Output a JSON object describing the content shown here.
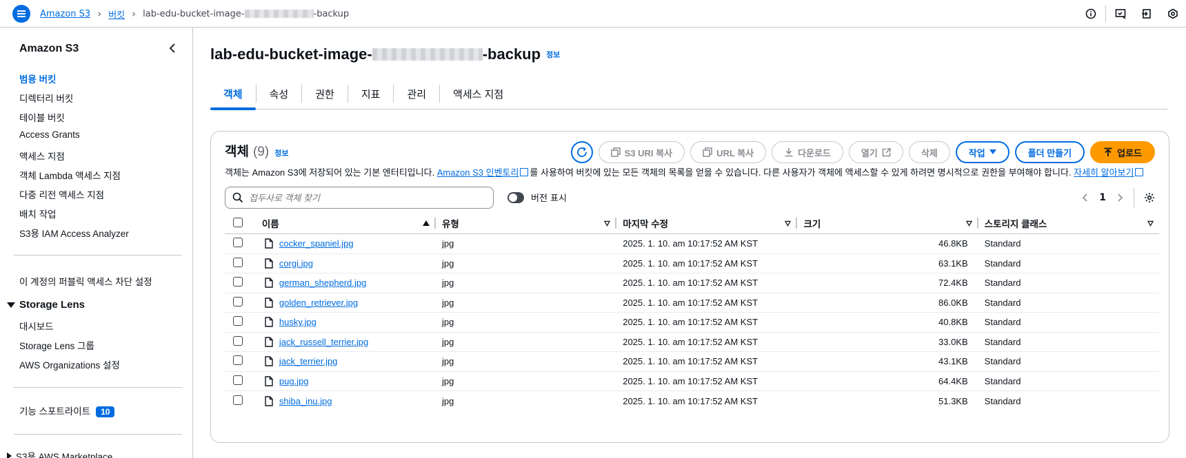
{
  "breadcrumb": {
    "root": "Amazon S3",
    "buckets": "버킷",
    "current_prefix": "lab-edu-bucket-image-",
    "current_suffix": "-backup"
  },
  "sidebar": {
    "title": "Amazon S3",
    "items": [
      {
        "label": "범용 버킷",
        "active": true
      },
      {
        "label": "디렉터리 버킷"
      },
      {
        "label": "테이블 버킷"
      },
      {
        "label": "Access Grants"
      },
      {
        "label": "액세스 지점"
      },
      {
        "label": "객체 Lambda 액세스 지점"
      },
      {
        "label": "다중 리전 액세스 지점"
      },
      {
        "label": "배치 작업"
      },
      {
        "label": "S3용 IAM Access Analyzer"
      }
    ],
    "public_block": "이 계정의 퍼블릭 액세스 차단 설정",
    "storage_lens": {
      "title": "Storage Lens",
      "items": [
        "대시보드",
        "Storage Lens 그룹",
        "AWS Organizations 설정"
      ]
    },
    "spotlight": {
      "label": "기능 스포트라이트",
      "badge": "10"
    },
    "marketplace": "S3용 AWS Marketplace"
  },
  "page": {
    "title_prefix": "lab-edu-bucket-image-",
    "title_suffix": "-backup",
    "info": "정보"
  },
  "tabs": [
    "객체",
    "속성",
    "권한",
    "지표",
    "관리",
    "액세스 지점"
  ],
  "objects": {
    "title": "객체",
    "count": "(9)",
    "info": "정보",
    "desc_1": "객체는 Amazon S3에 저장되어 있는 기본 엔터티입니다. ",
    "desc_link": "Amazon S3 인벤토리",
    "desc_2": "를 사용하여 버킷에 있는 모든 객체의 목록을 얻을 수 있습니다. 다른 사용자가 객체에 액세스할 수 있게 하려면 명시적으로 권한을 부여해야 합니다. ",
    "learn_more": "자세히 알아보기",
    "buttons": {
      "copy_s3_uri": "S3 URI 복사",
      "copy_url": "URL 복사",
      "download": "다운로드",
      "open": "열기",
      "delete": "삭제",
      "actions": "작업",
      "create_folder": "폴더 만들기",
      "upload": "업로드"
    },
    "search_placeholder": "접두사로 객체 찾기",
    "show_versions": "버전 표시",
    "page": "1",
    "columns": [
      "이름",
      "유형",
      "마지막 수정",
      "크기",
      "스토리지 클래스"
    ],
    "rows": [
      {
        "name": "cocker_spaniel.jpg",
        "type": "jpg",
        "modified": "2025. 1. 10. am 10:17:52 AM KST",
        "size": "46.8KB",
        "class": "Standard"
      },
      {
        "name": "corgi.jpg",
        "type": "jpg",
        "modified": "2025. 1. 10. am 10:17:52 AM KST",
        "size": "63.1KB",
        "class": "Standard"
      },
      {
        "name": "german_shepherd.jpg",
        "type": "jpg",
        "modified": "2025. 1. 10. am 10:17:52 AM KST",
        "size": "72.4KB",
        "class": "Standard"
      },
      {
        "name": "golden_retriever.jpg",
        "type": "jpg",
        "modified": "2025. 1. 10. am 10:17:52 AM KST",
        "size": "86.0KB",
        "class": "Standard"
      },
      {
        "name": "husky.jpg",
        "type": "jpg",
        "modified": "2025. 1. 10. am 10:17:52 AM KST",
        "size": "40.8KB",
        "class": "Standard"
      },
      {
        "name": "jack_russell_terrier.jpg",
        "type": "jpg",
        "modified": "2025. 1. 10. am 10:17:52 AM KST",
        "size": "33.0KB",
        "class": "Standard"
      },
      {
        "name": "jack_terrier.jpg",
        "type": "jpg",
        "modified": "2025. 1. 10. am 10:17:52 AM KST",
        "size": "43.1KB",
        "class": "Standard"
      },
      {
        "name": "pug.jpg",
        "type": "jpg",
        "modified": "2025. 1. 10. am 10:17:52 AM KST",
        "size": "64.4KB",
        "class": "Standard"
      },
      {
        "name": "shiba_inu.jpg",
        "type": "jpg",
        "modified": "2025. 1. 10. am 10:17:52 AM KST",
        "size": "51.3KB",
        "class": "Standard"
      }
    ]
  },
  "colors": {
    "accent": "#006ce0",
    "upload": "#ff9900",
    "border": "#c6c6cd"
  }
}
